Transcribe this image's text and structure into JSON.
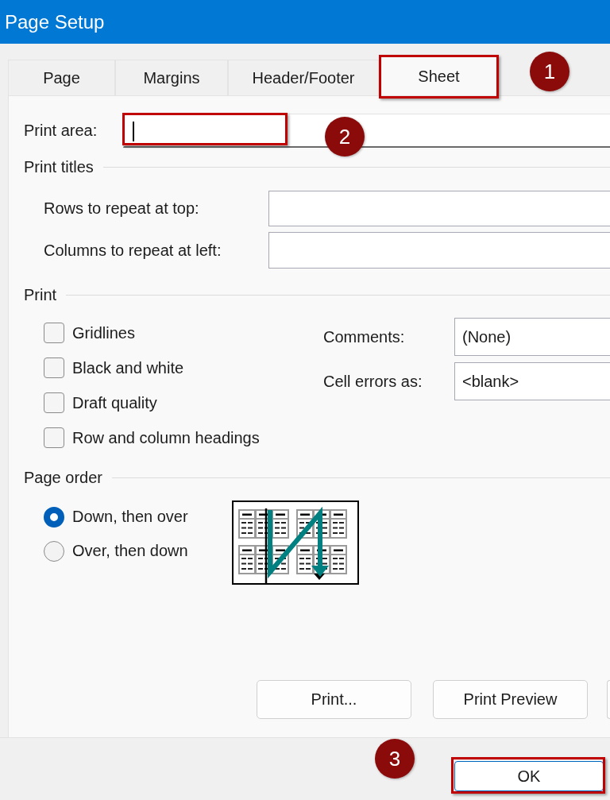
{
  "window": {
    "title": "Page Setup"
  },
  "tabs": [
    {
      "label": "Page",
      "selected": false
    },
    {
      "label": "Margins",
      "selected": false
    },
    {
      "label": "Header/Footer",
      "selected": false
    },
    {
      "label": "Sheet",
      "selected": true,
      "callout": "1"
    }
  ],
  "print_area": {
    "label": "Print area:",
    "focused": true,
    "callout": "2"
  },
  "print_titles": {
    "title": "Print titles",
    "fields": [
      {
        "label": "Rows to repeat at top:"
      },
      {
        "label": "Columns to repeat at left:"
      }
    ]
  },
  "print": {
    "title": "Print",
    "options": [
      {
        "label": "Gridlines",
        "checked": false
      },
      {
        "label": "Black and white",
        "checked": false
      },
      {
        "label": "Draft quality",
        "checked": false
      },
      {
        "label": "Row and column headings",
        "checked": false
      }
    ],
    "dropdowns": [
      {
        "label": "Comments:",
        "value": "(None)"
      },
      {
        "label": "Cell errors as:",
        "value": "<blank>"
      }
    ]
  },
  "page_order": {
    "title": "Page order",
    "options": [
      {
        "label": "Down, then over",
        "selected": true
      },
      {
        "label": "Over, then down",
        "selected": false
      }
    ]
  },
  "panel_buttons": [
    {
      "kind": "button",
      "label": "Print..."
    },
    {
      "kind": "button",
      "label": "Print Preview"
    },
    {
      "kind": "edge"
    }
  ],
  "footer_buttons": [
    {
      "label": "OK",
      "callout": "3"
    }
  ]
}
